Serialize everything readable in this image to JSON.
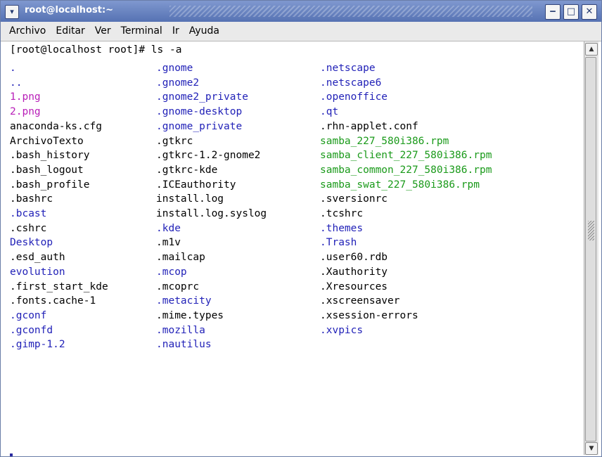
{
  "window": {
    "title": "root@localhost:~",
    "minimize_glyph": "‒",
    "maximize_glyph": "□",
    "close_glyph": "✕",
    "menu_glyph": "▾"
  },
  "menubar": {
    "items": [
      "Archivo",
      "Editar",
      "Ver",
      "Terminal",
      "Ir",
      "Ayuda"
    ]
  },
  "terminal": {
    "prompt": "[root@localhost root]# ls -a",
    "colors": {
      "file": "#000000",
      "dir": "#2222b8",
      "image": "#b81eb8",
      "package": "#1a9a1a"
    },
    "columns": [
      [
        {
          "name": ".",
          "kind": "dir"
        },
        {
          "name": "..",
          "kind": "dir"
        },
        {
          "name": "1.png",
          "kind": "image"
        },
        {
          "name": "2.png",
          "kind": "image"
        },
        {
          "name": "anaconda-ks.cfg",
          "kind": "file"
        },
        {
          "name": "ArchivoTexto",
          "kind": "file"
        },
        {
          "name": ".bash_history",
          "kind": "file"
        },
        {
          "name": ".bash_logout",
          "kind": "file"
        },
        {
          "name": ".bash_profile",
          "kind": "file"
        },
        {
          "name": ".bashrc",
          "kind": "file"
        },
        {
          "name": ".bcast",
          "kind": "dir"
        },
        {
          "name": ".cshrc",
          "kind": "file"
        },
        {
          "name": "Desktop",
          "kind": "dir"
        },
        {
          "name": ".esd_auth",
          "kind": "file"
        },
        {
          "name": "evolution",
          "kind": "dir"
        },
        {
          "name": ".first_start_kde",
          "kind": "file"
        },
        {
          "name": ".fonts.cache-1",
          "kind": "file"
        },
        {
          "name": ".gconf",
          "kind": "dir"
        },
        {
          "name": ".gconfd",
          "kind": "dir"
        },
        {
          "name": ".gimp-1.2",
          "kind": "dir"
        }
      ],
      [
        {
          "name": ".gnome",
          "kind": "dir"
        },
        {
          "name": ".gnome2",
          "kind": "dir"
        },
        {
          "name": ".gnome2_private",
          "kind": "dir"
        },
        {
          "name": ".gnome-desktop",
          "kind": "dir"
        },
        {
          "name": ".gnome_private",
          "kind": "dir"
        },
        {
          "name": ".gtkrc",
          "kind": "file"
        },
        {
          "name": ".gtkrc-1.2-gnome2",
          "kind": "file"
        },
        {
          "name": ".gtkrc-kde",
          "kind": "file"
        },
        {
          "name": ".ICEauthority",
          "kind": "file"
        },
        {
          "name": "install.log",
          "kind": "file"
        },
        {
          "name": "install.log.syslog",
          "kind": "file"
        },
        {
          "name": ".kde",
          "kind": "dir"
        },
        {
          "name": ".m1v",
          "kind": "file"
        },
        {
          "name": ".mailcap",
          "kind": "file"
        },
        {
          "name": ".mcop",
          "kind": "dir"
        },
        {
          "name": ".mcoprc",
          "kind": "file"
        },
        {
          "name": ".metacity",
          "kind": "dir"
        },
        {
          "name": ".mime.types",
          "kind": "file"
        },
        {
          "name": ".mozilla",
          "kind": "dir"
        },
        {
          "name": ".nautilus",
          "kind": "dir"
        }
      ],
      [
        {
          "name": ".netscape",
          "kind": "dir"
        },
        {
          "name": ".netscape6",
          "kind": "dir"
        },
        {
          "name": ".openoffice",
          "kind": "dir"
        },
        {
          "name": ".qt",
          "kind": "dir"
        },
        {
          "name": ".rhn-applet.conf",
          "kind": "file"
        },
        {
          "name": "samba_227_580i386.rpm",
          "kind": "package"
        },
        {
          "name": "samba_client_227_580i386.rpm",
          "kind": "package"
        },
        {
          "name": "samba_common_227_580i386.rpm",
          "kind": "package"
        },
        {
          "name": "samba_swat_227_580i386.rpm",
          "kind": "package"
        },
        {
          "name": ".sversionrc",
          "kind": "file"
        },
        {
          "name": ".tcshrc",
          "kind": "file"
        },
        {
          "name": ".themes",
          "kind": "dir"
        },
        {
          "name": ".Trash",
          "kind": "dir"
        },
        {
          "name": ".user60.rdb",
          "kind": "file"
        },
        {
          "name": ".Xauthority",
          "kind": "file"
        },
        {
          "name": ".Xresources",
          "kind": "file"
        },
        {
          "name": ".xscreensaver",
          "kind": "file"
        },
        {
          "name": ".xsession-errors",
          "kind": "file"
        },
        {
          "name": ".xvpics",
          "kind": "dir"
        }
      ]
    ]
  },
  "scrollbar": {
    "up_glyph": "▲",
    "down_glyph": "▼"
  }
}
